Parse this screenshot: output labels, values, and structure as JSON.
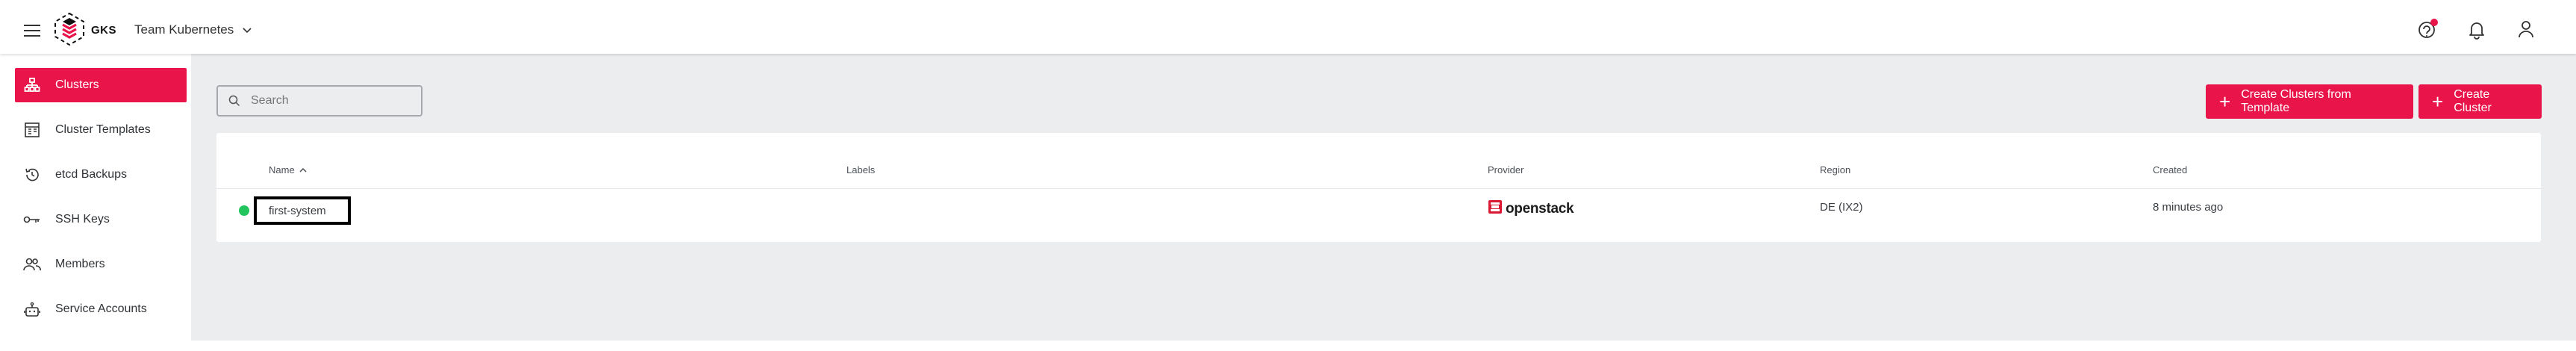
{
  "header": {
    "brand": "GKS",
    "project_name": "Team Kubernetes",
    "icons": [
      "menu-icon",
      "gks-logo",
      "help-icon",
      "bell-icon",
      "user-icon"
    ],
    "notification_dot_color": "#e8144a"
  },
  "sidebar": {
    "accent_color": "#e8144a",
    "items": [
      {
        "label": "Clusters",
        "icon": "sitemap-icon",
        "active": true
      },
      {
        "label": "Cluster Templates",
        "icon": "template-icon",
        "active": false
      },
      {
        "label": "etcd Backups",
        "icon": "restore-icon",
        "active": false
      },
      {
        "label": "SSH Keys",
        "icon": "key-icon",
        "active": false
      },
      {
        "label": "Members",
        "icon": "members-icon",
        "active": false
      },
      {
        "label": "Service Accounts",
        "icon": "robot-icon",
        "active": false
      }
    ]
  },
  "toolbar": {
    "search_placeholder": "Search",
    "create_from_template_label": "Create Clusters from Template",
    "create_cluster_label": "Create Cluster"
  },
  "table": {
    "columns": [
      "Name",
      "Labels",
      "Provider",
      "Region",
      "Created"
    ],
    "sort_column": "Name",
    "sort_direction": "ascending",
    "rows": [
      {
        "status": "healthy",
        "status_color": "#21c45d",
        "name": "first-system",
        "labels": "",
        "provider": "openstack",
        "region": "DE (IX2)",
        "created": "8 minutes ago"
      }
    ]
  }
}
